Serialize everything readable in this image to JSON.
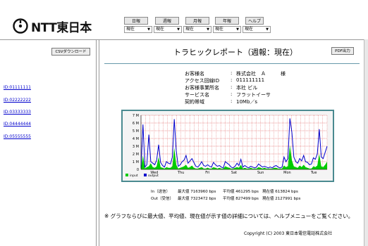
{
  "logo": {
    "text": "NTT東日本"
  },
  "tabs": [
    "日報",
    "週報",
    "月報",
    "年報",
    "ヘルプ"
  ],
  "selects": [
    "現在",
    "現在",
    "現在",
    "現在",
    "現在"
  ],
  "sidebar": {
    "csv_button": "CSVダウンロード",
    "links": [
      "ID:01111111",
      "ID:02222222",
      "ID:03333333",
      "ID:04444444",
      "ID:05555555"
    ]
  },
  "main": {
    "title": "トラヒックレポート（週報：現在）",
    "pdf_button": "PDF出力",
    "info": [
      {
        "label": "お客様名",
        "value": "株式会社　Ａ　　　様"
      },
      {
        "label": "アクセス回線ID",
        "value": "011111111"
      },
      {
        "label": "お客様事業所名",
        "value": "本社 ビル"
      },
      {
        "label": "サービス名",
        "value": "フラットイーサ"
      },
      {
        "label": "契約帯域",
        "value": "10Mb／s"
      }
    ],
    "stats": [
      {
        "label": "In（送信）",
        "max": "最大値 7163960 bps",
        "avg": "平均値 461295 bps",
        "cur": "現在値 613824 bps"
      },
      {
        "label": "Out（受信）",
        "max": "最大値 7323472 bps",
        "avg": "平均値 827499 bps",
        "cur": "現在値 2127991 bps"
      }
    ],
    "notice": "※ グラフならびに最大値、平均値、現在値が示す値の詳細については、ヘルプメニューをご覧ください。",
    "copyright": "Copyright (C) 2003 東日本電信電話株式会社"
  },
  "chart_data": {
    "type": "area",
    "y_tick_labels": [
      "7 M",
      "6 M",
      "5 M",
      "4 M",
      "3 M",
      "2 M",
      "1 M",
      "0"
    ],
    "ylim": [
      0,
      7
    ],
    "x_tick_labels": [
      "Wed",
      "Thu",
      "Fri",
      "Sat",
      "Sun",
      "Mon",
      "Tue"
    ],
    "legend": [
      "input",
      "output"
    ],
    "colors": {
      "input": "#00cc00",
      "output": "#0000cc",
      "grid": "#cc0000",
      "frame": "#4a8a90",
      "bg": "#f4f4f4"
    },
    "series": [
      {
        "name": "input",
        "values": [
          0.2,
          1.8,
          0.1,
          0.3,
          0.4,
          0.8,
          0.3,
          0.2,
          0.4,
          1.6,
          0.3,
          0.2,
          0.1,
          0.3,
          0.2,
          0.2,
          0.4,
          2.8,
          0.6,
          0.1,
          0.2,
          0.3,
          0.4,
          0.6,
          0.2,
          0.3,
          0.5,
          0.2,
          0.1,
          0.1,
          0.2,
          0.3,
          0.1,
          0.1,
          0.2,
          0.1,
          0.1,
          0.3,
          0.2,
          0.1,
          0.2,
          0.1,
          0.1,
          0.4,
          0.3,
          0.2,
          0.1,
          0.1,
          0.2,
          0.3,
          0.2,
          0.6,
          0.1,
          0.2,
          0.1,
          0.1,
          0.2,
          0.1,
          0.1,
          0.1,
          0.3,
          0.2,
          0.1,
          0.2,
          0.1,
          0.1,
          0.1,
          0.1,
          0.2,
          0.2,
          0.1,
          0.1,
          0.1,
          0.5,
          0.3,
          0.4,
          3.1,
          1.2,
          0.4,
          0.3,
          0.2,
          0.5,
          0.3,
          0.6,
          0.3,
          0.2,
          0.1,
          0.1,
          0.4,
          0.3,
          0.5,
          2.0,
          0.4,
          0.3,
          0.6,
          1.0
        ]
      },
      {
        "name": "output",
        "values": [
          0.2,
          5.8,
          0.3,
          0.6,
          4.5,
          1.0,
          0.8,
          0.6,
          1.2,
          3.2,
          0.9,
          0.5,
          0.3,
          1.0,
          0.8,
          0.7,
          1.6,
          6.5,
          2.4,
          0.4,
          0.6,
          1.0,
          1.2,
          1.8,
          0.8,
          1.1,
          1.4,
          0.9,
          0.4,
          0.3,
          0.6,
          1.0,
          0.5,
          0.4,
          0.6,
          0.4,
          0.3,
          0.9,
          0.6,
          0.4,
          0.5,
          0.3,
          0.2,
          1.0,
          0.8,
          0.6,
          0.3,
          0.2,
          0.4,
          0.8,
          0.5,
          1.3,
          0.3,
          0.5,
          0.3,
          0.2,
          0.4,
          0.3,
          0.2,
          0.3,
          0.7,
          0.5,
          0.3,
          0.4,
          0.3,
          0.2,
          0.3,
          0.2,
          0.4,
          0.5,
          0.3,
          0.2,
          0.3,
          1.6,
          1.0,
          1.4,
          6.6,
          4.8,
          1.6,
          1.0,
          0.8,
          1.4,
          1.1,
          1.8,
          1.0,
          0.9,
          0.6,
          0.7,
          1.5,
          1.3,
          2.0,
          5.2,
          1.6,
          1.4,
          2.2,
          3.0
        ]
      }
    ]
  }
}
